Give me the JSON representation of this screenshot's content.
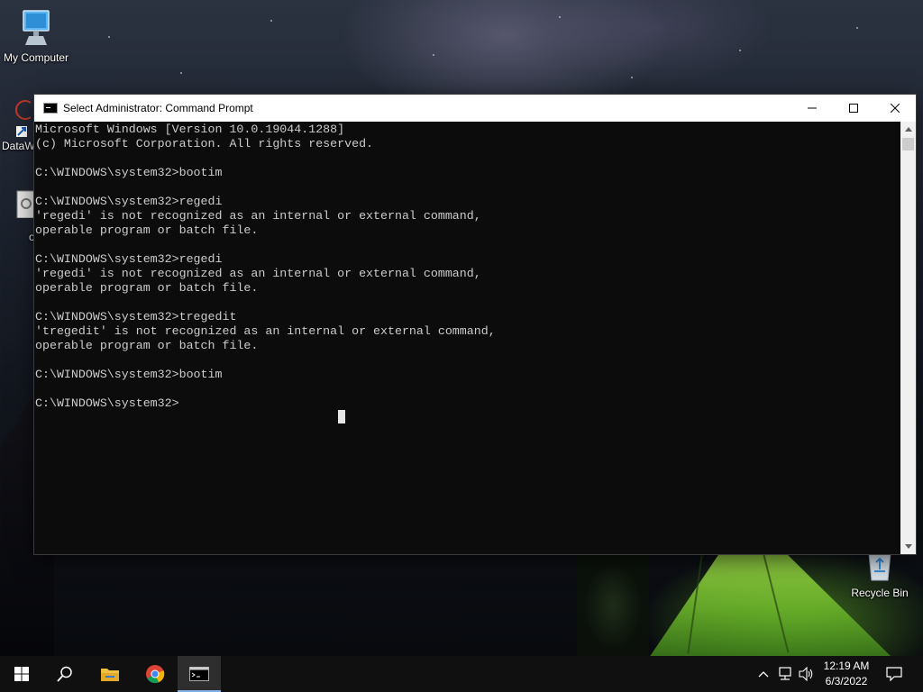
{
  "desktop": {
    "icons": [
      {
        "label": "My Computer",
        "icon": "computer-icon"
      },
      {
        "label": "DataW",
        "icon": "datawarehouse-shortcut-icon"
      },
      {
        "label": "o",
        "icon": "settings-shortcut-icon"
      },
      {
        "label": "Recycle Bin",
        "icon": "recycle-bin-icon"
      }
    ]
  },
  "window": {
    "title": "Select Administrator: Command Prompt",
    "controls": {
      "minimize": "—",
      "maximize": "☐",
      "close": "✕"
    },
    "console_lines": [
      "Microsoft Windows [Version 10.0.19044.1288]",
      "(c) Microsoft Corporation. All rights reserved.",
      "",
      "C:\\WINDOWS\\system32>bootim",
      "",
      "C:\\WINDOWS\\system32>regedi",
      "'regedi' is not recognized as an internal or external command,",
      "operable program or batch file.",
      "",
      "C:\\WINDOWS\\system32>regedi",
      "'regedi' is not recognized as an internal or external command,",
      "operable program or batch file.",
      "",
      "C:\\WINDOWS\\system32>tregedit",
      "'tregedit' is not recognized as an internal or external command,",
      "operable program or batch file.",
      "",
      "C:\\WINDOWS\\system32>bootim",
      "",
      "C:\\WINDOWS\\system32>"
    ]
  },
  "taskbar": {
    "items": [
      "start-icon",
      "search-icon",
      "file-explorer-icon",
      "chrome-icon",
      "command-prompt-icon"
    ],
    "active_item": "command-prompt-icon",
    "tray": {
      "chevron": "^",
      "time": "12:19 AM",
      "date": "6/3/2022"
    }
  },
  "colors": {
    "console_bg": "#0c0c0c",
    "console_text": "#cccccc",
    "taskbar_bg": "#101010",
    "active_indicator": "#7fb0e6"
  }
}
